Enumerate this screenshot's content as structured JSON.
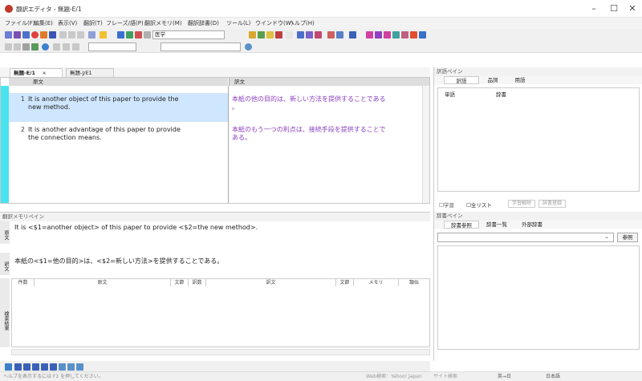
{
  "window": {
    "title": "翻訳エディタ - 無題-E/1",
    "min": "–",
    "max": "☐",
    "close": "✕"
  },
  "menu": [
    "ファイル(F)",
    "編集(E)",
    "表示(V)",
    "翻訳(T)",
    "フレーズ/語(P)",
    "翻訳メモリ(M)",
    "翻訳辞書(D)",
    "ツール(L)",
    "ウインドウ(W)",
    "ヘルプ(H)"
  ],
  "toolbar": {
    "combo_label": "医学"
  },
  "doc_tabs": [
    {
      "label": "無題-E/1",
      "close": "×"
    },
    {
      "label": "無題-J/E1"
    }
  ],
  "editor": {
    "col_source": "原文",
    "col_target": "訳文",
    "rows": [
      {
        "num": "1",
        "source_l1": "It is another object of this paper to provide the",
        "source_l2": "new method.",
        "target_l1": "本紙の他の目的は、新しい方法を提供することである",
        "target_l2": "。"
      },
      {
        "num": "2",
        "source_l1": "It is another advantage of this paper to provide",
        "source_l2": "the connection means.",
        "target_l1": "本紙のもう一つの利点は、接続手段を提供することで",
        "target_l2": "ある。"
      }
    ]
  },
  "yakugo_pane": {
    "title": "訳語ペイン",
    "tabs": [
      "訳語",
      "品詞",
      "用語"
    ],
    "cols": [
      "単語",
      "辞書"
    ],
    "checks": [
      "学習",
      "全リスト"
    ],
    "buttons": [
      "学習解除",
      "辞書登録"
    ]
  },
  "memory_pane": {
    "title": "翻訳メモリペイン",
    "source_label": "原文",
    "source_text": "It is <$1=another object> of this paper to provide <$2=the new method>.",
    "target_label": "訳文",
    "target_text": "本紙の<$1=他の目的>は、<$2=新しい方法>を提供することである。",
    "result_label": "検索結果",
    "grid_cols": [
      "件数",
      "原文",
      "文節",
      "訳数",
      "訳文",
      "文節",
      "メモリ",
      "類似"
    ]
  },
  "dict_pane": {
    "title": "辞書ペイン",
    "tabs": [
      "辞書参照",
      "辞書一覧",
      "外部辞書"
    ],
    "button": "参照"
  },
  "statusbar": {
    "help": "ヘルプを表示するには F1 を押してください。",
    "web": "Web検索：Yahoo! Japan",
    "site": "サイト検索",
    "lang": "英→日",
    "lang2": "日本語"
  },
  "colors": {
    "purple": "#8a3fbf",
    "cyan": "#48e3ef",
    "selected": "#cfe6ff"
  }
}
